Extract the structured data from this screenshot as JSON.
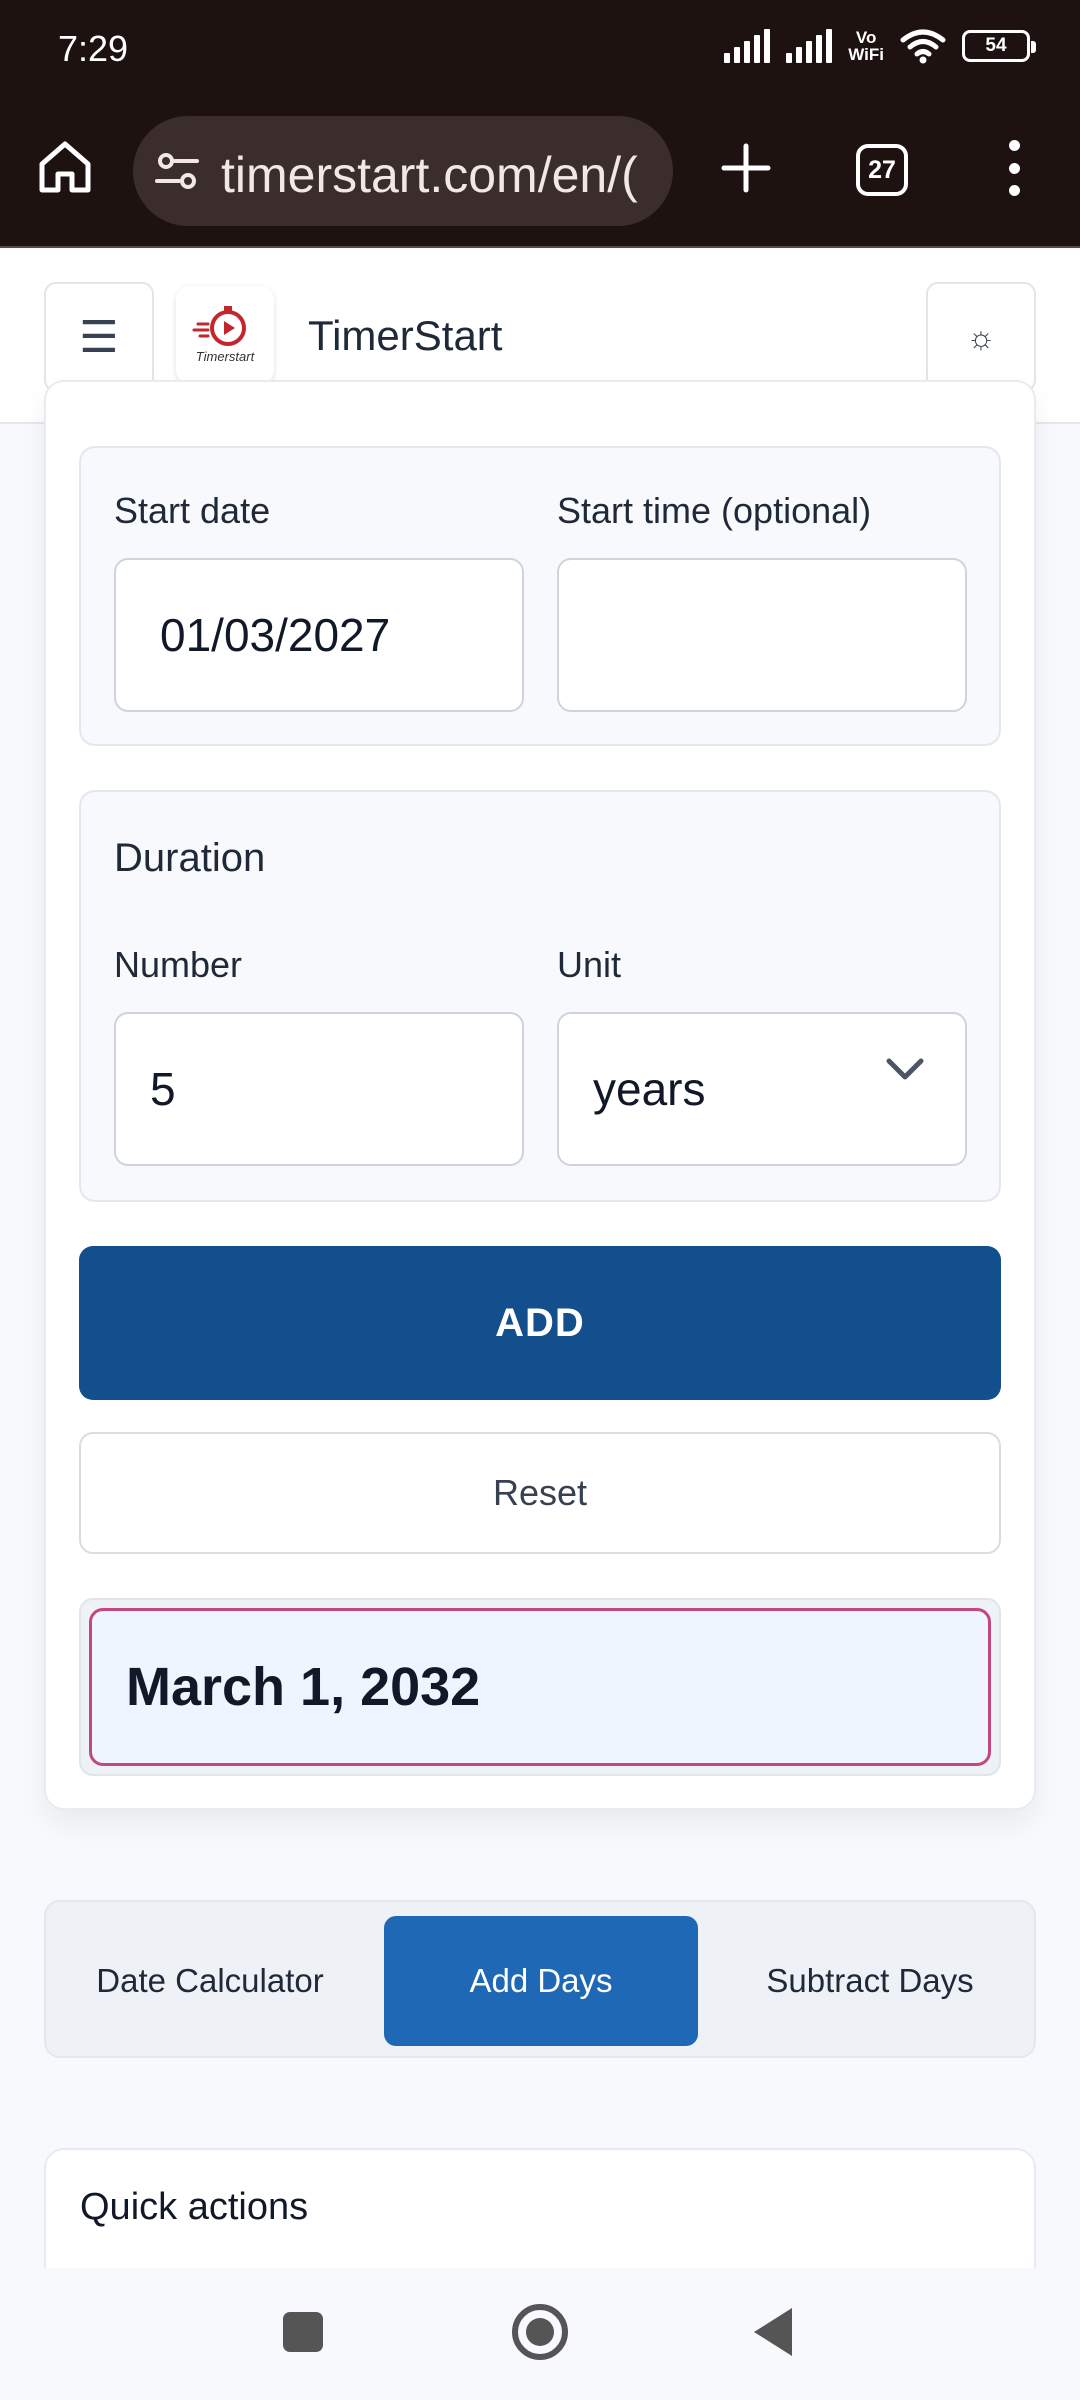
{
  "status_bar": {
    "time": "7:29",
    "network_label": "Vo\nWiFi",
    "battery": "54"
  },
  "browser": {
    "url": "timerstart.com/en/(",
    "tab_count": "27"
  },
  "site_header": {
    "menu_glyph": "☰",
    "brand": "TimerStart",
    "logo_text": "Timerstart",
    "theme_glyph": "☼"
  },
  "form": {
    "start_date_label": "Start date",
    "start_date_value": "01/03/2027",
    "start_time_label": "Start time (optional)",
    "start_time_value": "",
    "duration_title": "Duration",
    "number_label": "Number",
    "number_value": "5",
    "unit_label": "Unit",
    "unit_value": "years",
    "add_label": "ADD",
    "reset_label": "Reset",
    "result": "March 1, 2032"
  },
  "tabs": [
    {
      "label": "Date Calculator",
      "active": false
    },
    {
      "label": "Add Days",
      "active": true
    },
    {
      "label": "Subtract Days",
      "active": false
    }
  ],
  "quick_actions": {
    "title": "Quick actions"
  },
  "colors": {
    "primary": "#124f8c",
    "tab_active": "#1f68b6",
    "result_border": "#c2487c",
    "browser_bg": "#1d1210"
  }
}
